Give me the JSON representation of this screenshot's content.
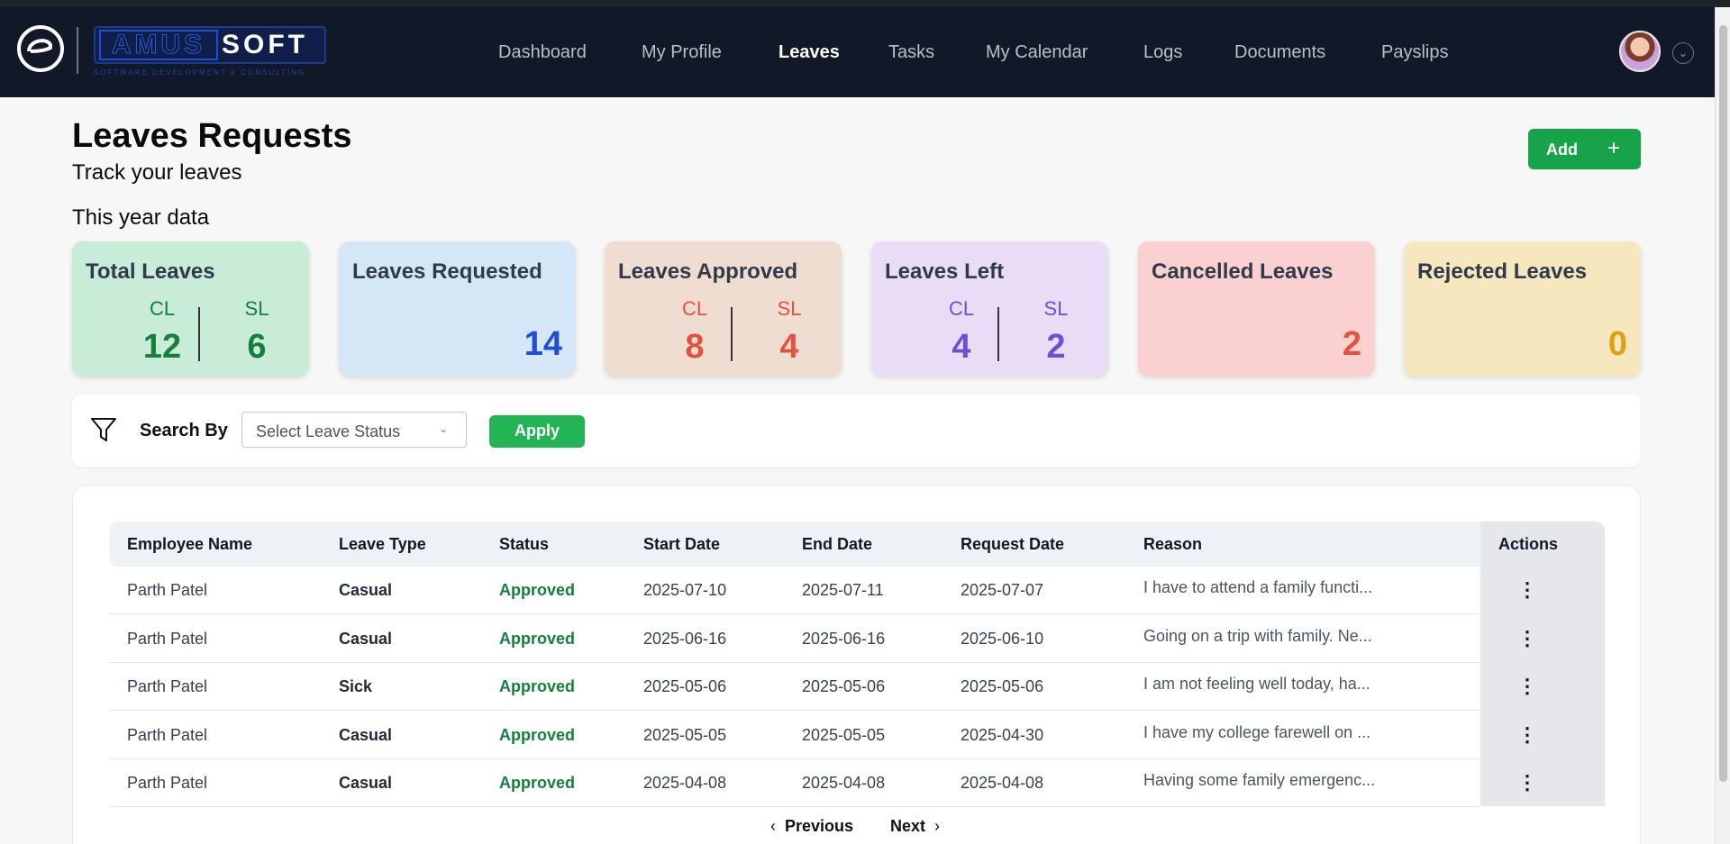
{
  "brand": {
    "name_part1": "AMUS",
    "name_part2": "SOFT",
    "tagline": "SOFTWARE DEVELOPMENT & CONSULTING"
  },
  "nav": {
    "items": [
      "Dashboard",
      "My Profile",
      "Leaves",
      "Tasks",
      "My Calendar",
      "Logs",
      "Documents",
      "Payslips"
    ],
    "active": "Leaves"
  },
  "header": {
    "title": "Leaves Requests",
    "subtitle": "Track your leaves",
    "section": "This year data",
    "add_label": "Add",
    "add_icon": "+"
  },
  "cards": {
    "total": {
      "title": "Total Leaves",
      "cl_label": "CL",
      "cl_value": "12",
      "sl_label": "SL",
      "sl_value": "6",
      "bg": "#c8ecd7",
      "color": "#15803d"
    },
    "requested": {
      "title": "Leaves Requested",
      "value": "14",
      "bg": "#d5e6f7",
      "color": "#1d4ed8"
    },
    "approved": {
      "title": "Leaves Approved",
      "cl_label": "CL",
      "cl_value": "8",
      "sl_label": "SL",
      "sl_value": "4",
      "bg": "#f0ddd2",
      "color": "#e0533d"
    },
    "left": {
      "title": "Leaves Left",
      "cl_label": "CL",
      "cl_value": "4",
      "sl_label": "SL",
      "sl_value": "2",
      "bg": "#e8dcf6",
      "color": "#6d4fd6"
    },
    "cancelled": {
      "title": "Cancelled Leaves",
      "value": "2",
      "bg": "#fbd0d0",
      "color": "#e0533d"
    },
    "rejected": {
      "title": "Rejected Leaves",
      "value": "0",
      "bg": "#f6e7bf",
      "color": "#e0a010"
    }
  },
  "filter": {
    "label": "Search By",
    "placeholder": "Select Leave Status",
    "apply_label": "Apply"
  },
  "table": {
    "columns": [
      "Employee Name",
      "Leave Type",
      "Status",
      "Start Date",
      "End Date",
      "Request Date",
      "Reason",
      "Actions"
    ],
    "rows": [
      {
        "name": "Parth Patel",
        "type": "Casual",
        "status": "Approved",
        "start": "2025-07-10",
        "end": "2025-07-11",
        "request": "2025-07-07",
        "reason": "I have to attend a family functi..."
      },
      {
        "name": "Parth Patel",
        "type": "Casual",
        "status": "Approved",
        "start": "2025-06-16",
        "end": "2025-06-16",
        "request": "2025-06-10",
        "reason": "Going on a trip with family. Ne..."
      },
      {
        "name": "Parth Patel",
        "type": "Sick",
        "status": "Approved",
        "start": "2025-05-06",
        "end": "2025-05-06",
        "request": "2025-05-06",
        "reason": "I am not feeling well today, ha..."
      },
      {
        "name": "Parth Patel",
        "type": "Casual",
        "status": "Approved",
        "start": "2025-05-05",
        "end": "2025-05-05",
        "request": "2025-04-30",
        "reason": "I have my college farewell on ..."
      },
      {
        "name": "Parth Patel",
        "type": "Casual",
        "status": "Approved",
        "start": "2025-04-08",
        "end": "2025-04-08",
        "request": "2025-04-08",
        "reason": "Having some family emergenc..."
      }
    ]
  },
  "pagination": {
    "previous": "Previous",
    "next": "Next"
  }
}
